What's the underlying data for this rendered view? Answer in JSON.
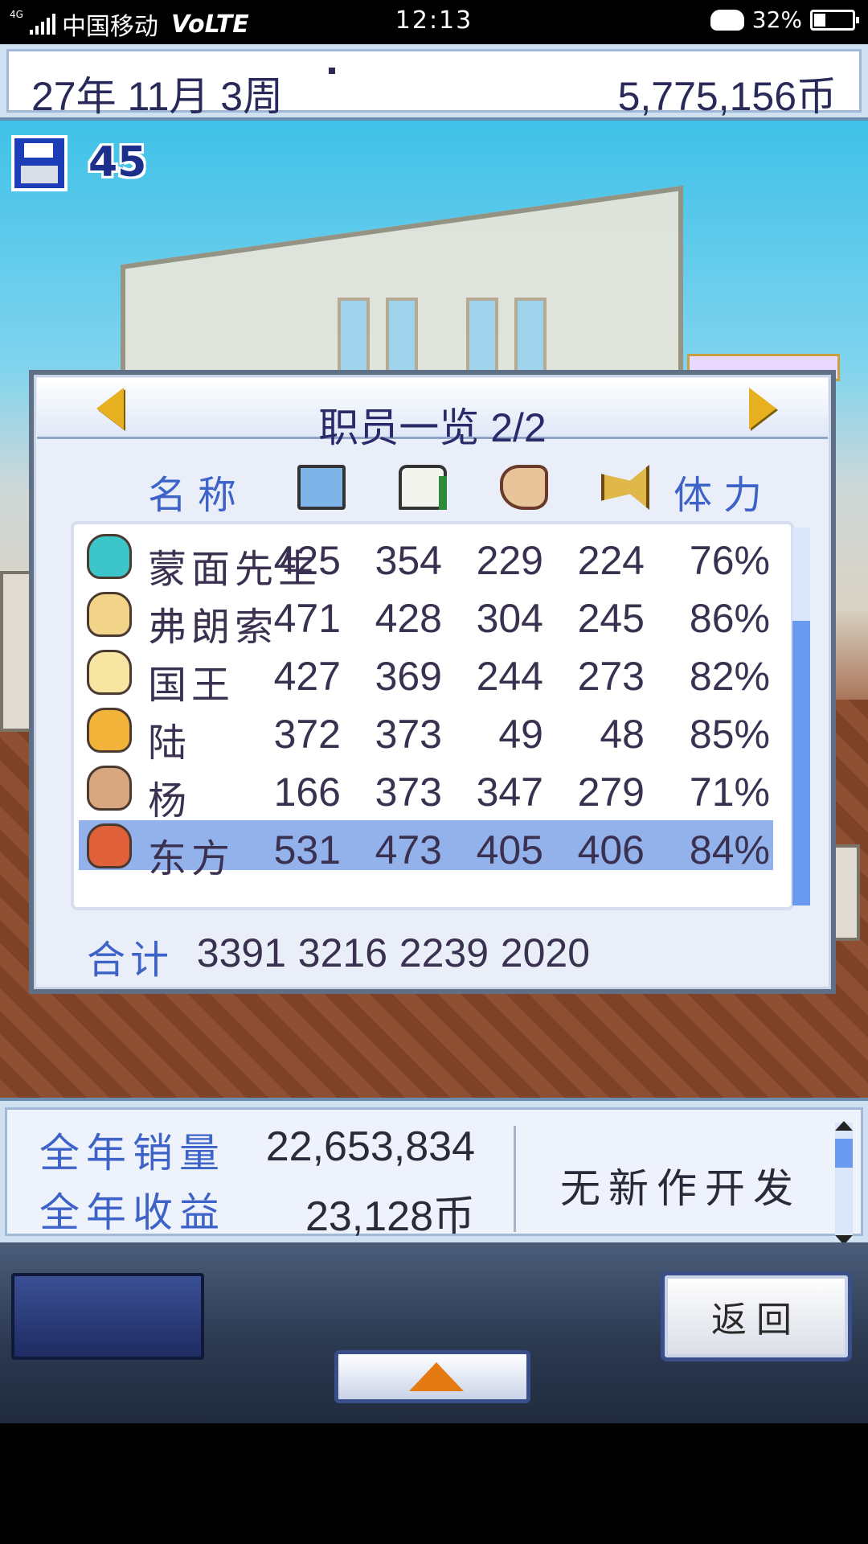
{
  "status_bar": {
    "network_badge": "4G",
    "carrier": "中国移动",
    "volte": "VoLTE",
    "time": "12:13",
    "battery": "32%"
  },
  "top_bar": {
    "date": "27年 11月 3周",
    "money": "5,775,156币"
  },
  "save": {
    "count": "45"
  },
  "staff_panel": {
    "title": "职员一览 2/2",
    "col_name": "名称",
    "col_stamina": "体力",
    "header_icons": [
      "computer-icon",
      "book-icon",
      "art-palette-icon",
      "trumpet-icon"
    ],
    "rows": [
      {
        "name": "蒙面先生",
        "v1": "425",
        "v2": "354",
        "v3": "229",
        "v4": "224",
        "stamina": "76%",
        "selected": false
      },
      {
        "name": "弗朗索",
        "v1": "471",
        "v2": "428",
        "v3": "304",
        "v4": "245",
        "stamina": "86%",
        "selected": false
      },
      {
        "name": "国王",
        "v1": "427",
        "v2": "369",
        "v3": "244",
        "v4": "273",
        "stamina": "82%",
        "selected": false
      },
      {
        "name": "陆",
        "v1": "372",
        "v2": "373",
        "v3": "49",
        "v4": "48",
        "stamina": "85%",
        "selected": false
      },
      {
        "name": "杨",
        "v1": "166",
        "v2": "373",
        "v3": "347",
        "v4": "279",
        "stamina": "71%",
        "selected": false
      },
      {
        "name": "东方",
        "v1": "531",
        "v2": "473",
        "v3": "405",
        "v4": "406",
        "stamina": "84%",
        "selected": true
      }
    ],
    "total_label": "合计",
    "totals": [
      "3391",
      "3216",
      "2239",
      "2020"
    ]
  },
  "info_bar": {
    "annual_sales_label": "全年销量",
    "annual_sales_value": "22,653,834",
    "annual_profit_label": "全年收益",
    "annual_profit_value": "23,128币",
    "status": "无新作开发"
  },
  "controls": {
    "back_label": "返回"
  },
  "colors": {
    "accent_blue": "#3d63c8",
    "selected_row": "#93b1ea",
    "arrow_gold": "#e7b021",
    "up_arrow": "#e67a12"
  }
}
